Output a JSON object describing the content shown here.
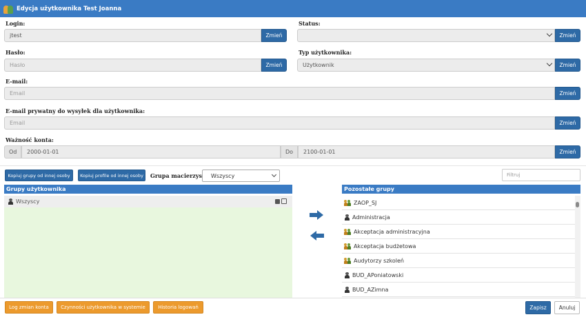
{
  "window": {
    "title": "Edycja użytkownika Test Joanna"
  },
  "form": {
    "login_label": "Login:",
    "login_value": "jtest",
    "status_label": "Status:",
    "status_value": "",
    "password_label": "Hasło:",
    "password_placeholder": "Hasło",
    "user_type_label": "Typ użytkownika:",
    "user_type_value": "Użytkownik",
    "email_label": "E-mail:",
    "email_placeholder": "Email",
    "private_email_label": "E-mail prywatny do wysyłek dla użytkownika:",
    "private_email_placeholder": "Email",
    "validity_label": "Ważność konta:",
    "from_label": "Od",
    "from_value": "2000-01-01",
    "to_label": "Do",
    "to_value": "2100-01-01",
    "change_label": "Zmień"
  },
  "toolbar": {
    "copy_groups_label": "Kopiuj grupy od innej osoby",
    "copy_profile_label": "Kopiuj profile od innej osoby",
    "parent_group_label": "Grupa macierzysta:",
    "parent_group_value": "Wszyscy",
    "filter_placeholder": "Filtruj"
  },
  "user_groups": {
    "header": "Grupy użytkownika",
    "items": [
      "Wszyscy"
    ]
  },
  "other_groups": {
    "header": "Pozostałe grupy",
    "items": [
      "ZAOP_SJ",
      "Administracja",
      "Akceptacja administracyjna",
      "Akceptacja budżetowa",
      "Audytorzy szkoleń",
      "BUD_APoniatowski",
      "BUD_AZimna"
    ]
  },
  "footer": {
    "log_label": "Log zmian konta",
    "activity_label": "Czynności użytkownika w systemie",
    "history_label": "Historia logowań",
    "save_label": "Zapisz",
    "cancel_label": "Anuluj"
  },
  "colors": {
    "accent": "#3a7bc4",
    "button": "#2e6aa6",
    "orange": "#ec9a2d",
    "green_panel": "#e8f7de"
  }
}
